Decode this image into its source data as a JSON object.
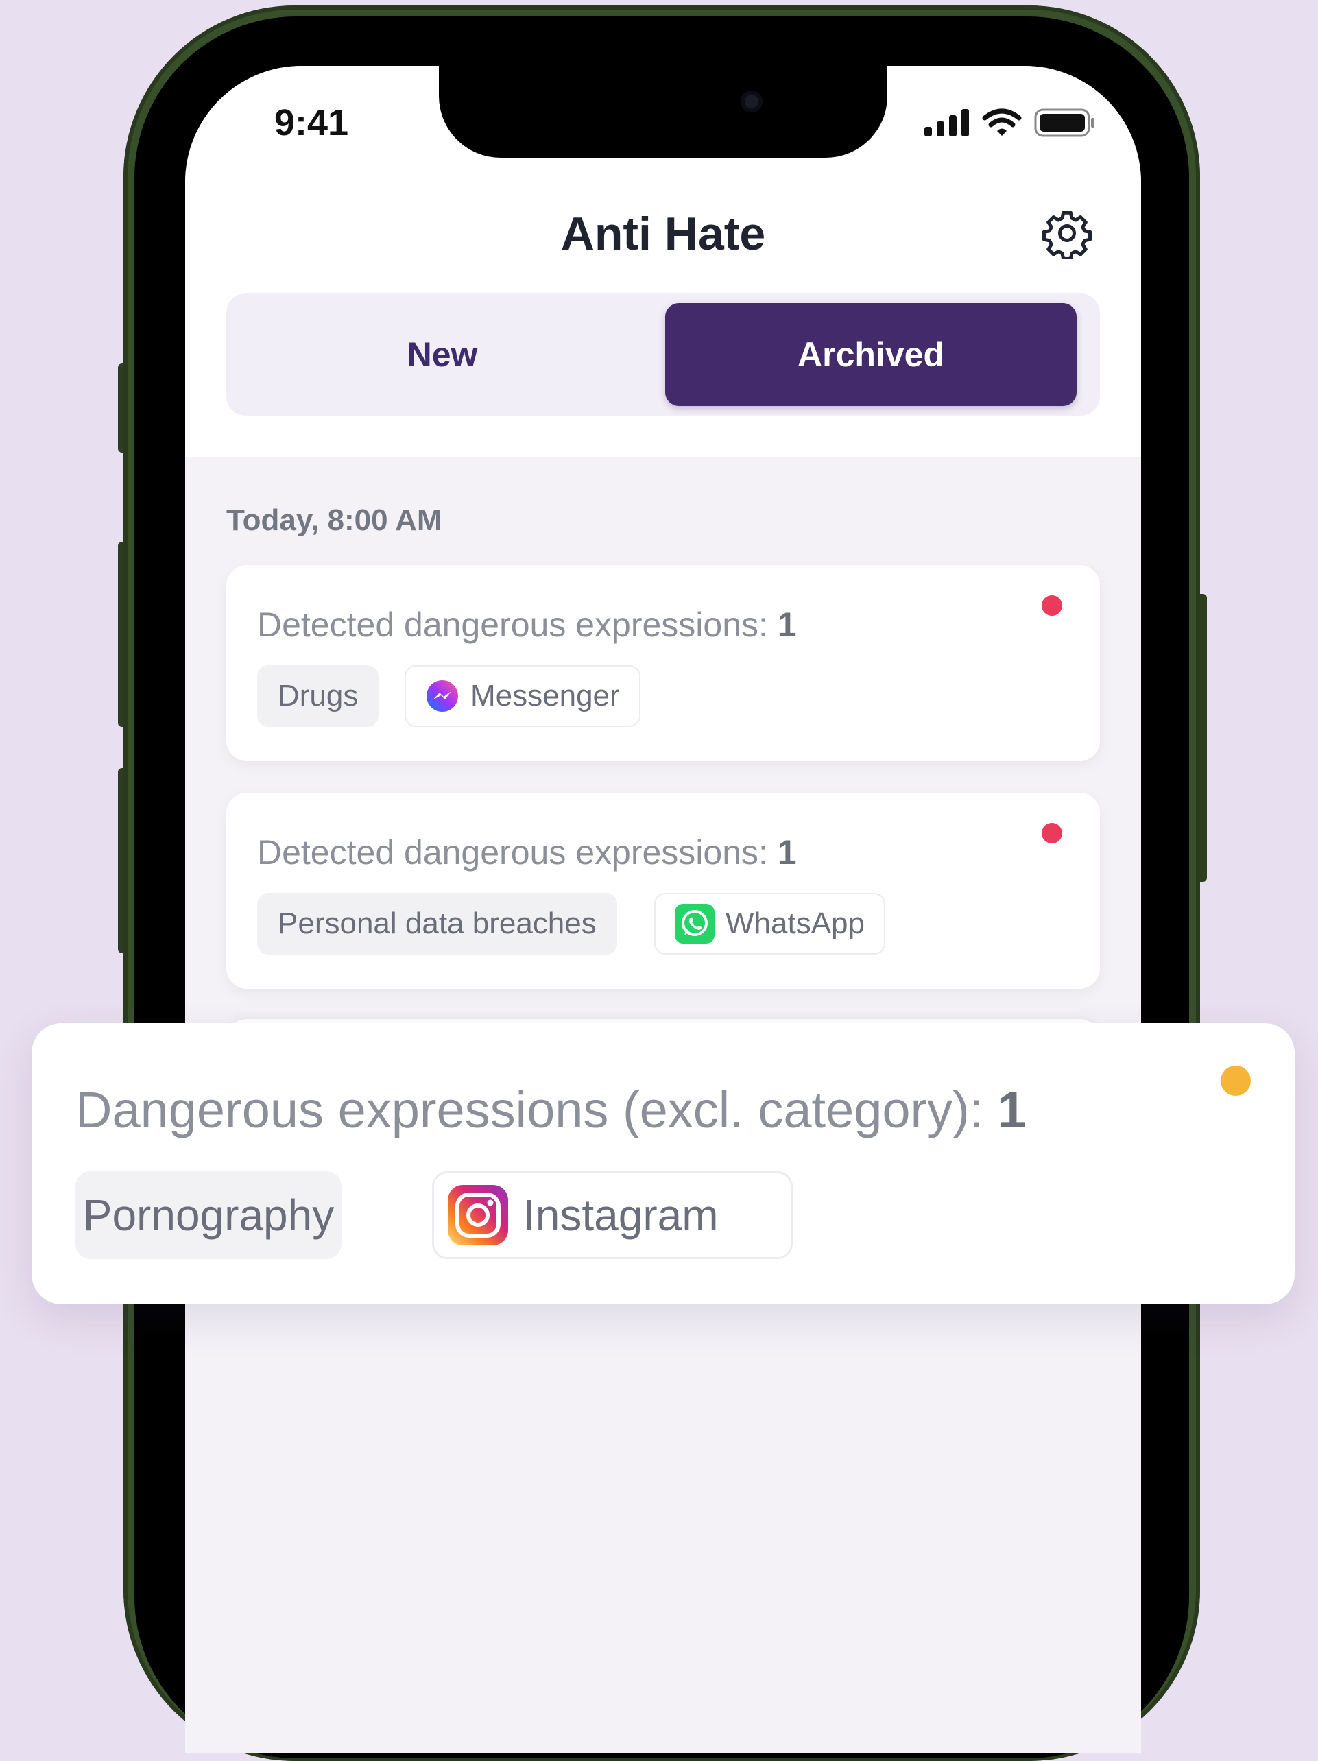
{
  "status_bar": {
    "time": "9:41"
  },
  "header": {
    "title": "Anti Hate",
    "settings_icon": "gear-icon"
  },
  "tabs": [
    {
      "label": "New",
      "active": false
    },
    {
      "label": "Archived",
      "active": true
    }
  ],
  "feed": {
    "timestamp": "Today, 8:00 AM",
    "items": [
      {
        "title_prefix": "Detected dangerous expressions: ",
        "count": "1",
        "category": "Drugs",
        "app": "Messenger",
        "app_icon": "messenger-icon",
        "status_color": "#ea3b5c"
      },
      {
        "title_prefix": "Detected dangerous expressions: ",
        "count": "1",
        "category": "Personal data breaches",
        "app": "WhatsApp",
        "app_icon": "whatsapp-icon",
        "status_color": "#ea3b5c"
      }
    ]
  },
  "highlight_card": {
    "title_prefix": "Dangerous expressions (excl. category): ",
    "count": "1",
    "category": "Pornography",
    "app": "Instagram",
    "app_icon": "instagram-icon",
    "status_color": "#f7b538"
  },
  "colors": {
    "accent": "#432a6b",
    "background": "#e8dff0",
    "alert_red": "#ea3b5c",
    "alert_orange": "#f7b538"
  }
}
